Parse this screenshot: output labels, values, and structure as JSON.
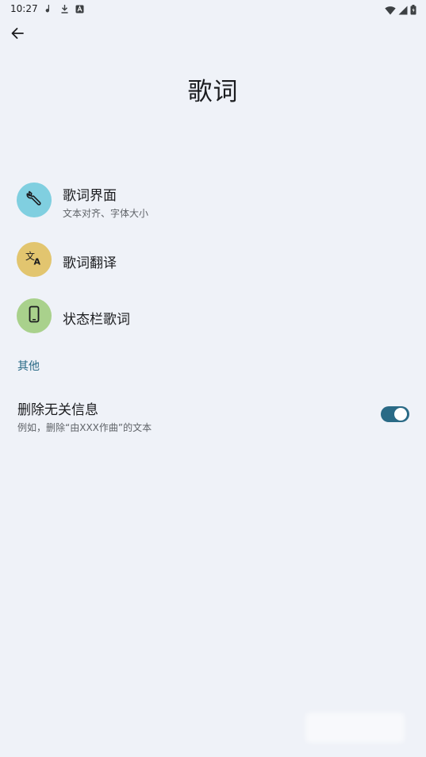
{
  "status_bar": {
    "time": "10:27",
    "left_icons": [
      "music-note-icon",
      "download-icon",
      "font-a-icon"
    ],
    "right_icons": [
      "wifi-icon",
      "signal-icon",
      "battery-icon"
    ]
  },
  "header": {
    "title": "歌词"
  },
  "items": [
    {
      "title": "歌词界面",
      "subtitle": "文本对齐、字体大小",
      "icon": "wrench-icon",
      "icon_color": "#80cfe0"
    },
    {
      "title": "歌词翻译",
      "icon": "translate-icon",
      "icon_color": "#e2c56f"
    },
    {
      "title": "状态栏歌词",
      "icon": "phone-icon",
      "icon_color": "#a9d18c"
    }
  ],
  "other_section": {
    "header": "其他",
    "toggle_item": {
      "title": "删除无关信息",
      "subtitle": "例如，删除“由XXX作曲”的文本",
      "enabled": true
    }
  },
  "colors": {
    "background": "#eff2f8",
    "accent": "#2a6a86"
  }
}
